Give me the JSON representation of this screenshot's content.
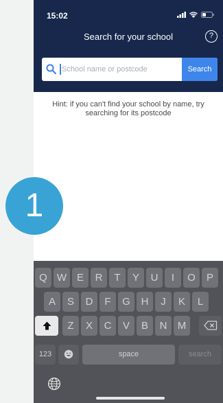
{
  "status_bar": {
    "time": "15:02"
  },
  "header": {
    "title": "Search for your school",
    "help_label": "?"
  },
  "search": {
    "placeholder": "School name or postcode",
    "value": "",
    "button_label": "Search"
  },
  "hint": "Hint: if you can't find your school by name, try searching for its postcode",
  "step_badge": "1",
  "keyboard": {
    "row1": [
      "Q",
      "W",
      "E",
      "R",
      "T",
      "Y",
      "U",
      "I",
      "O",
      "P"
    ],
    "row2": [
      "A",
      "S",
      "D",
      "F",
      "G",
      "H",
      "J",
      "K",
      "L"
    ],
    "row3": [
      "Z",
      "X",
      "C",
      "V",
      "B",
      "N",
      "M"
    ],
    "numbers_label": "123",
    "space_label": "space",
    "return_label": "search"
  },
  "colors": {
    "header_bg": "#18284d",
    "accent": "#3f86ea",
    "badge": "#3aa3d6",
    "keyboard_bg": "#515358"
  }
}
